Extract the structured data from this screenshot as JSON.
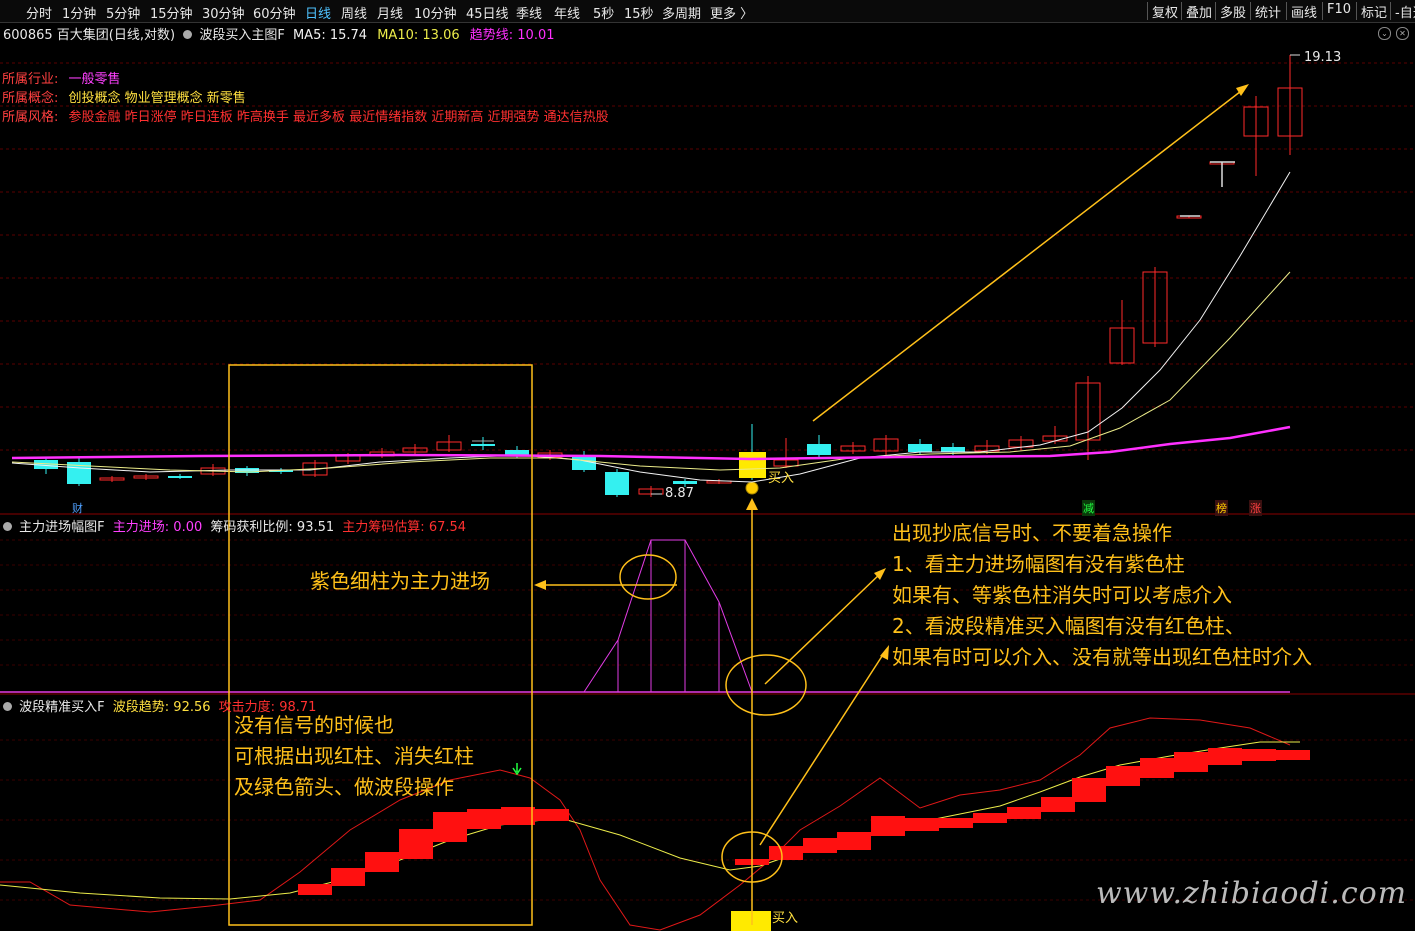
{
  "toolbar": {
    "periods": [
      "分时",
      "1分钟",
      "5分钟",
      "15分钟",
      "30分钟",
      "60分钟",
      "日线",
      "周线",
      "月线",
      "10分钟",
      "45日线",
      "季线",
      "年线",
      "5秒",
      "15秒",
      "多周期",
      "更多 〉"
    ],
    "active_period": "日线",
    "right_buttons": [
      "复权",
      "叠加",
      "多股",
      "统计",
      "画线",
      "F10",
      "标记",
      "-自选"
    ]
  },
  "main_header": {
    "stock": "600865 百大集团(日线,对数)",
    "indicator": "波段买入主图F",
    "ma5_label": "MA5:",
    "ma5_value": "15.74",
    "ma10_label": "MA10:",
    "ma10_value": "13.06",
    "trend_label": "趋势线:",
    "trend_value": "10.01"
  },
  "stock_info": {
    "industry_label": "所属行业:",
    "industry_value": "一般零售",
    "concept_label": "所属概念:",
    "concept_value": "创投概念 物业管理概念 新零售",
    "style_label": "所属风格:",
    "style_value": "参股金融 昨日涨停 昨日连板 昨高换手 最近多板 最近情绪指数 近期新高 近期强势 通达信热股"
  },
  "price_labels": {
    "high": "19.13",
    "low": "8.87",
    "buy": "买入",
    "buy_bottom": "买入"
  },
  "markers": {
    "cai": "财",
    "jian": "减",
    "bang": "榜",
    "zhang": "涨"
  },
  "panel2_header": {
    "name": "主力进场幅图F",
    "entry_label": "主力进场:",
    "entry_value": "0.00",
    "chip_label": "筹码获利比例:",
    "chip_value": "93.51",
    "cost_label": "主力筹码估算:",
    "cost_value": "67.54"
  },
  "panel3_header": {
    "name": "波段精准买入F",
    "trend_label": "波段趋势:",
    "trend_value": "92.56",
    "attack_label": "攻击力度:",
    "attack_value": "98.71"
  },
  "annotations": {
    "purple_bar": "紫色细柱为主力进场",
    "right_block": [
      "出现抄底信号时、不要着急操作",
      "1、看主力进场幅图有没有紫色柱",
      "如果有、等紫色柱消失时可以考虑介入",
      "2、看波段精准买入幅图有没有红色柱、",
      "如果有时可以介入、没有就等出现红色柱时介入"
    ],
    "left_block": [
      "没有信号的时候也",
      "可根据出现红柱、消失红柱",
      "及绿色箭头、做波段操作"
    ],
    "watermark": "www.zhibiaodi.com"
  },
  "colors": {
    "up": "#ff2a2a",
    "down": "#34f0f0",
    "ma5": "#f2f2f2",
    "ma10": "#ecec8a",
    "trend": "#ff30ff",
    "annotation": "#ffc01a",
    "panel_purple": "#e23ce6"
  },
  "icons": {
    "close": "close-icon",
    "settings": "gear-icon"
  }
}
